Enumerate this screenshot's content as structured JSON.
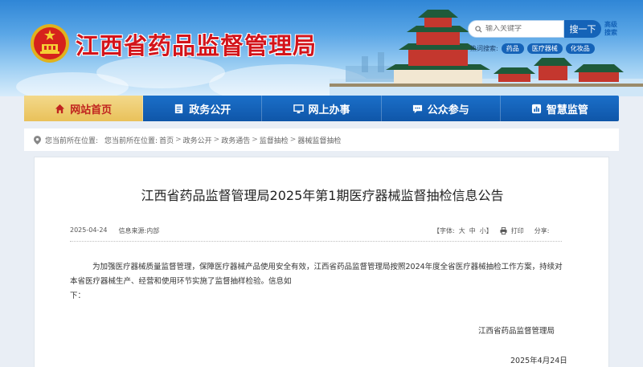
{
  "header": {
    "site_title": "江西省药品监督管理局",
    "search_placeholder": "输入关键字",
    "search_button": "搜一下",
    "advanced_search": "高级搜索",
    "hot_search_label": "热词搜索:",
    "hot_tags": [
      "药品",
      "医疗器械",
      "化妆品"
    ]
  },
  "nav": {
    "items": [
      {
        "label": "网站首页",
        "icon": "home-icon",
        "active": true
      },
      {
        "label": "政务公开",
        "icon": "document-icon",
        "active": false
      },
      {
        "label": "网上办事",
        "icon": "monitor-icon",
        "active": false
      },
      {
        "label": "公众参与",
        "icon": "chat-icon",
        "active": false
      },
      {
        "label": "智慧监管",
        "icon": "chart-icon",
        "active": false
      }
    ]
  },
  "breadcrumb": {
    "prefix": "您当前所在位置:",
    "label": "您当前所在位置:",
    "items": [
      "首页",
      "政务公开",
      "政务通告",
      "监督抽检",
      "器械监督抽检"
    ]
  },
  "article": {
    "title": "江西省药品监督管理局2025年第1期医疗器械监督抽检信息公告",
    "date": "2025-04-24",
    "source": "信息来源:内部",
    "font_label": "【字体:",
    "font_large": "大",
    "font_medium": "中",
    "font_small": "小】",
    "print": "打印",
    "share": "分享:",
    "paragraph_1": "为加强医疗器械质量监督管理，保障医疗器械产品使用安全有效，江西省药品监督管理局按照2024年度全省医疗器械抽检工作方案，持续对本省医疗器械生产、经营和使用环节实施了监督抽样检验。信息如",
    "paragraph_2": "下：",
    "signature_org": "江西省药品监督管理局",
    "signature_date": "2025年4月24日"
  },
  "colors": {
    "brand_red": "#d3141b",
    "nav_blue": "#1563b8",
    "nav_active": "#e9c15a"
  }
}
